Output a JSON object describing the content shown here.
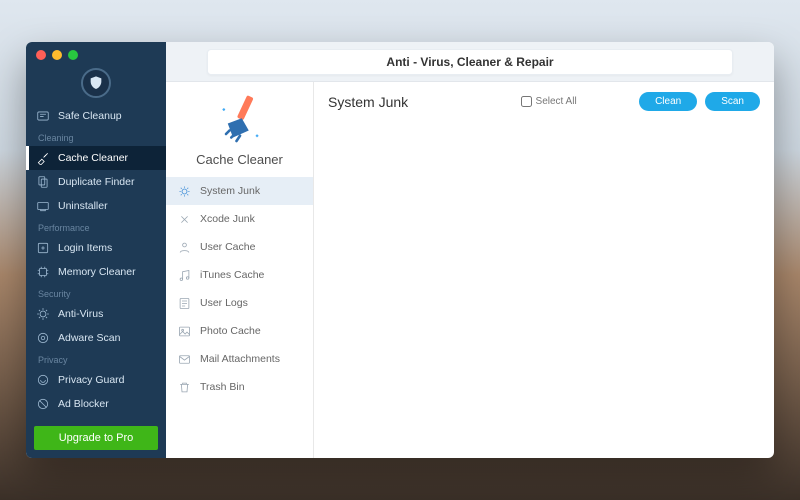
{
  "header": {
    "title": "Anti - Virus, Cleaner & Repair"
  },
  "sidebar": {
    "top_item": "Safe Cleanup",
    "groups": [
      {
        "label": "Cleaning",
        "items": [
          "Cache Cleaner",
          "Duplicate Finder",
          "Uninstaller"
        ]
      },
      {
        "label": "Performance",
        "items": [
          "Login Items",
          "Memory Cleaner"
        ]
      },
      {
        "label": "Security",
        "items": [
          "Anti-Virus",
          "Adware Scan"
        ]
      },
      {
        "label": "Privacy",
        "items": [
          "Privacy Guard",
          "Ad Blocker"
        ]
      }
    ],
    "upgrade": "Upgrade to Pro"
  },
  "category_pane": {
    "title": "Cache Cleaner",
    "items": [
      "System Junk",
      "Xcode Junk",
      "User Cache",
      "iTunes Cache",
      "User Logs",
      "Photo Cache",
      "Mail Attachments",
      "Trash Bin"
    ]
  },
  "main": {
    "title": "System Junk",
    "select_all": "Select All",
    "clean": "Clean",
    "scan": "Scan"
  }
}
